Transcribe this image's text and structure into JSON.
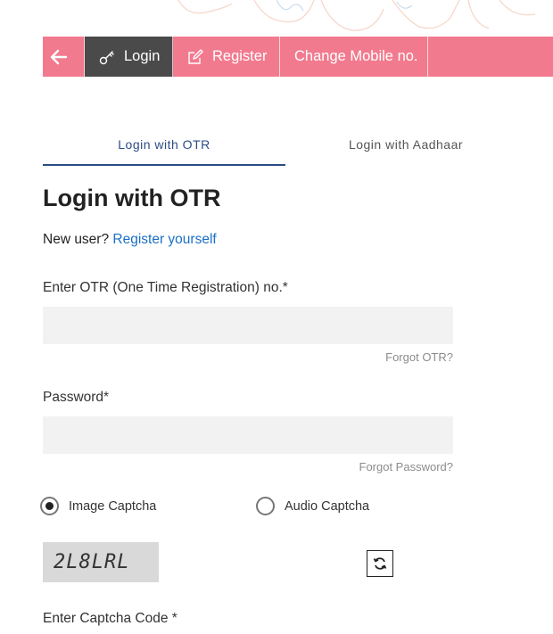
{
  "nav": {
    "back_icon": "arrow-left-icon",
    "login_label": "Login",
    "login_icon": "key-icon",
    "register_label": "Register",
    "register_icon": "edit-icon",
    "change_mobile_label": "Change Mobile no.",
    "bar_color": "#f27a8e",
    "active_color": "#4a4a4a"
  },
  "tabs": [
    {
      "label": "Login with OTR",
      "active": true
    },
    {
      "label": "Login with Aadhaar",
      "active": false
    }
  ],
  "form": {
    "title": "Login with OTR",
    "new_user_text": "New user?",
    "register_link": "Register yourself",
    "otr_label": "Enter OTR (One Time Registration) no.*",
    "otr_value": "",
    "forgot_otr": "Forgot OTR?",
    "password_label": "Password*",
    "password_value": "",
    "forgot_password": "Forgot Password?",
    "captcha_options": [
      {
        "label": "Image Captcha",
        "selected": true
      },
      {
        "label": "Audio Captcha",
        "selected": false
      }
    ],
    "captcha_text": "2L8LRL",
    "refresh_icon": "refresh-icon",
    "captcha_code_label": "Enter Captcha Code *"
  }
}
